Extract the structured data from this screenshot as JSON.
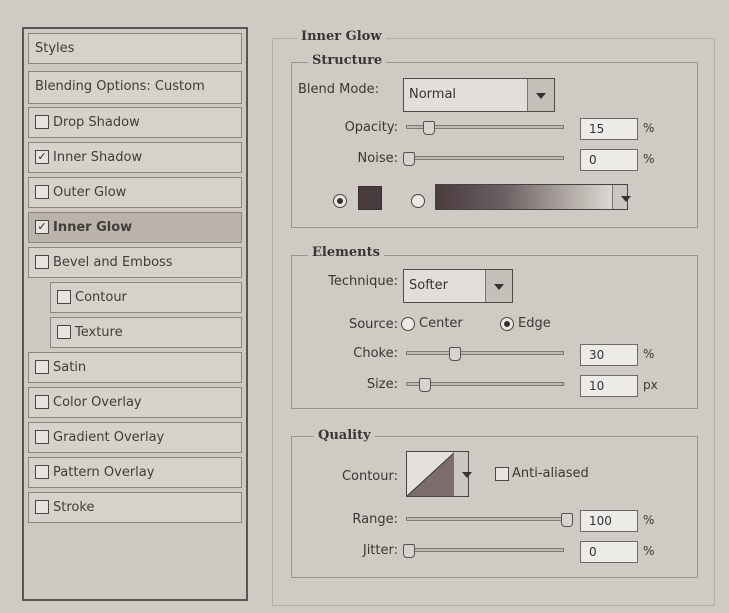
{
  "styles_panel": {
    "header": "Styles",
    "blending": "Blending Options: Custom",
    "items": [
      {
        "label": "Drop Shadow",
        "checked": false
      },
      {
        "label": "Inner Shadow",
        "checked": true
      },
      {
        "label": "Outer Glow",
        "checked": false
      },
      {
        "label": "Inner Glow",
        "checked": true
      },
      {
        "label": "Bevel and Emboss",
        "checked": false
      },
      {
        "label": "Contour",
        "checked": false
      },
      {
        "label": "Texture",
        "checked": false
      },
      {
        "label": "Satin",
        "checked": false
      },
      {
        "label": "Color Overlay",
        "checked": false
      },
      {
        "label": "Gradient Overlay",
        "checked": false
      },
      {
        "label": "Pattern Overlay",
        "checked": false
      },
      {
        "label": "Stroke",
        "checked": false
      }
    ],
    "check_mark": "✓"
  },
  "inner_glow": {
    "title": "Inner Glow",
    "structure": {
      "title": "Structure",
      "blend_mode_label": "Blend Mode:",
      "blend_mode_value": "Normal",
      "opacity_label": "Opacity:",
      "opacity_value": "15",
      "opacity_unit": "%",
      "noise_label": "Noise:",
      "noise_value": "0",
      "noise_unit": "%",
      "glow_color": "#4a3c3e"
    },
    "elements": {
      "title": "Elements",
      "technique_label": "Technique:",
      "technique_value": "Softer",
      "source_label": "Source:",
      "source_center": "Center",
      "source_edge": "Edge",
      "choke_label": "Choke:",
      "choke_value": "30",
      "choke_unit": "%",
      "size_label": "Size:",
      "size_value": "10",
      "size_unit": "px"
    },
    "quality": {
      "title": "Quality",
      "contour_label": "Contour:",
      "anti_aliased_label": "Anti-aliased",
      "range_label": "Range:",
      "range_value": "100",
      "range_unit": "%",
      "jitter_label": "Jitter:",
      "jitter_value": "0",
      "jitter_unit": "%"
    }
  }
}
